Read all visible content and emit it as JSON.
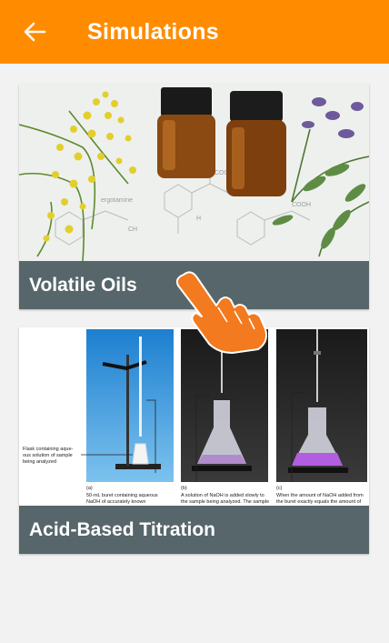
{
  "appbar": {
    "title": "Simulations",
    "back_icon": "arrow-left-icon",
    "color": "#ff8c00"
  },
  "cards": [
    {
      "label": "Volatile Oils",
      "image_icon": "essential-oils-photo"
    },
    {
      "label": "Acid-Based Titration",
      "image_icon": "titration-photo",
      "captions": {
        "side": [
          "Flask containing aque-",
          "ous solution of sample",
          "being analyzed"
        ],
        "a": [
          "(a)",
          "50-mL buret containing aqueous",
          "NaOH of accurately known"
        ],
        "b": [
          "(b)",
          "A solution of NaOH is added slowly to",
          "the sample being analyzed. The sample"
        ],
        "c": [
          "(c)",
          "When the amount of NaOH added from",
          "the buret exactly equals the amount of"
        ]
      }
    }
  ],
  "overlay": {
    "icon": "tap-hand-icon"
  },
  "colors": {
    "label_bar": "#56666b",
    "background": "#f2f2f2"
  }
}
